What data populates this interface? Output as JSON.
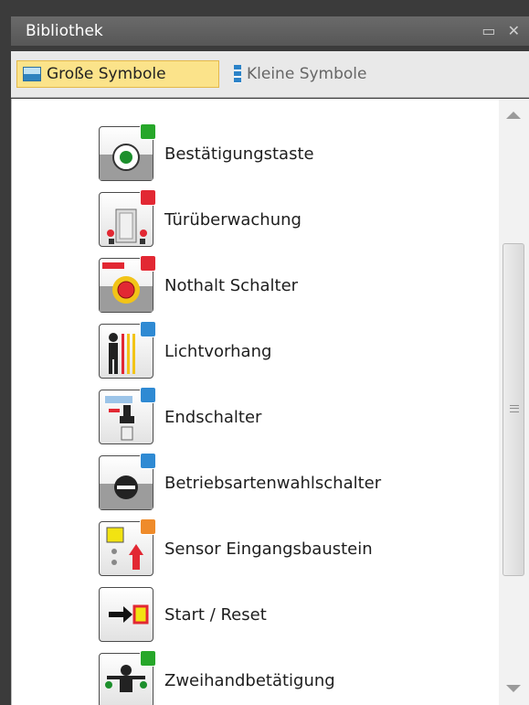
{
  "panel": {
    "title": "Bibliothek",
    "restore_icon": "restore-icon",
    "close_icon": "close-icon"
  },
  "toolbar": {
    "large_label": "Große Symbole",
    "small_label": "Kleine Symbole",
    "large_icon": "large-icons-icon",
    "small_icon": "small-icons-icon"
  },
  "items": [
    {
      "label": "Bestätigungstaste",
      "badge": "#27a72a",
      "icon": "confirm-button-icon"
    },
    {
      "label": "Türüberwachung",
      "badge": "#e22833",
      "icon": "door-monitor-icon"
    },
    {
      "label": "Nothalt Schalter",
      "badge": "#e22833",
      "icon": "emergency-stop-icon"
    },
    {
      "label": "Lichtvorhang",
      "badge": "#2f8ad3",
      "icon": "light-curtain-icon"
    },
    {
      "label": "Endschalter",
      "badge": "#2f8ad3",
      "icon": "limit-switch-icon"
    },
    {
      "label": "Betriebsartenwahlschalter",
      "badge": "#2f8ad3",
      "icon": "mode-selector-icon"
    },
    {
      "label": "Sensor Eingangsbaustein",
      "badge": "#ef8b2a",
      "icon": "sensor-input-icon"
    },
    {
      "label": "Start / Reset",
      "badge": "",
      "icon": "start-reset-icon"
    },
    {
      "label": "Zweihandbetätigung",
      "badge": "#27a72a",
      "icon": "two-hand-icon"
    }
  ]
}
